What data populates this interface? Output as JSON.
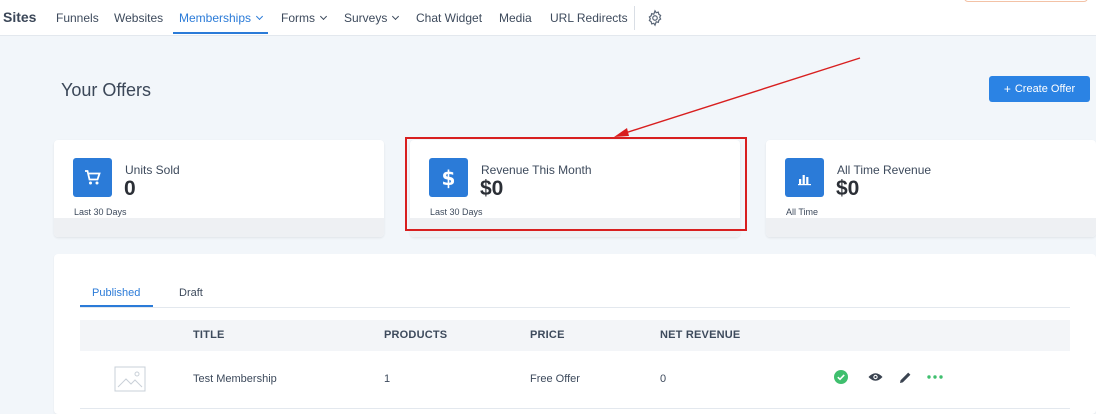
{
  "nav": {
    "title": "Sites",
    "items": [
      {
        "label": "Funnels"
      },
      {
        "label": "Websites"
      },
      {
        "label": "Memberships"
      },
      {
        "label": "Forms"
      },
      {
        "label": "Surveys"
      },
      {
        "label": "Chat Widget"
      },
      {
        "label": "Media"
      },
      {
        "label": "URL Redirects"
      }
    ],
    "active": "Memberships",
    "settings_icon": "gear-icon"
  },
  "header": {
    "title": "Your Offers",
    "create_label": "Create Offer",
    "create_icon": "plus-icon"
  },
  "cards": [
    {
      "label": "Units Sold",
      "value": "0",
      "period": "Last 30 Days",
      "icon": "cart-icon"
    },
    {
      "label": "Revenue This Month",
      "value": "$0",
      "period": "Last 30 Days",
      "icon": "dollar-icon"
    },
    {
      "label": "All Time Revenue",
      "value": "$0",
      "period": "All Time",
      "icon": "bar-chart-icon"
    }
  ],
  "tabs": [
    {
      "label": "Published"
    },
    {
      "label": "Draft"
    }
  ],
  "active_tab": "Published",
  "table": {
    "columns": [
      "TITLE",
      "PRODUCTS",
      "PRICE",
      "NET REVENUE"
    ],
    "rows": [
      {
        "title": "Test Membership",
        "products": "1",
        "price": "Free Offer",
        "net_revenue": "0"
      }
    ]
  },
  "colors": {
    "accent": "#2b7bd8",
    "annotation": "#d81f1f",
    "published_status": "#3fbf6e"
  }
}
